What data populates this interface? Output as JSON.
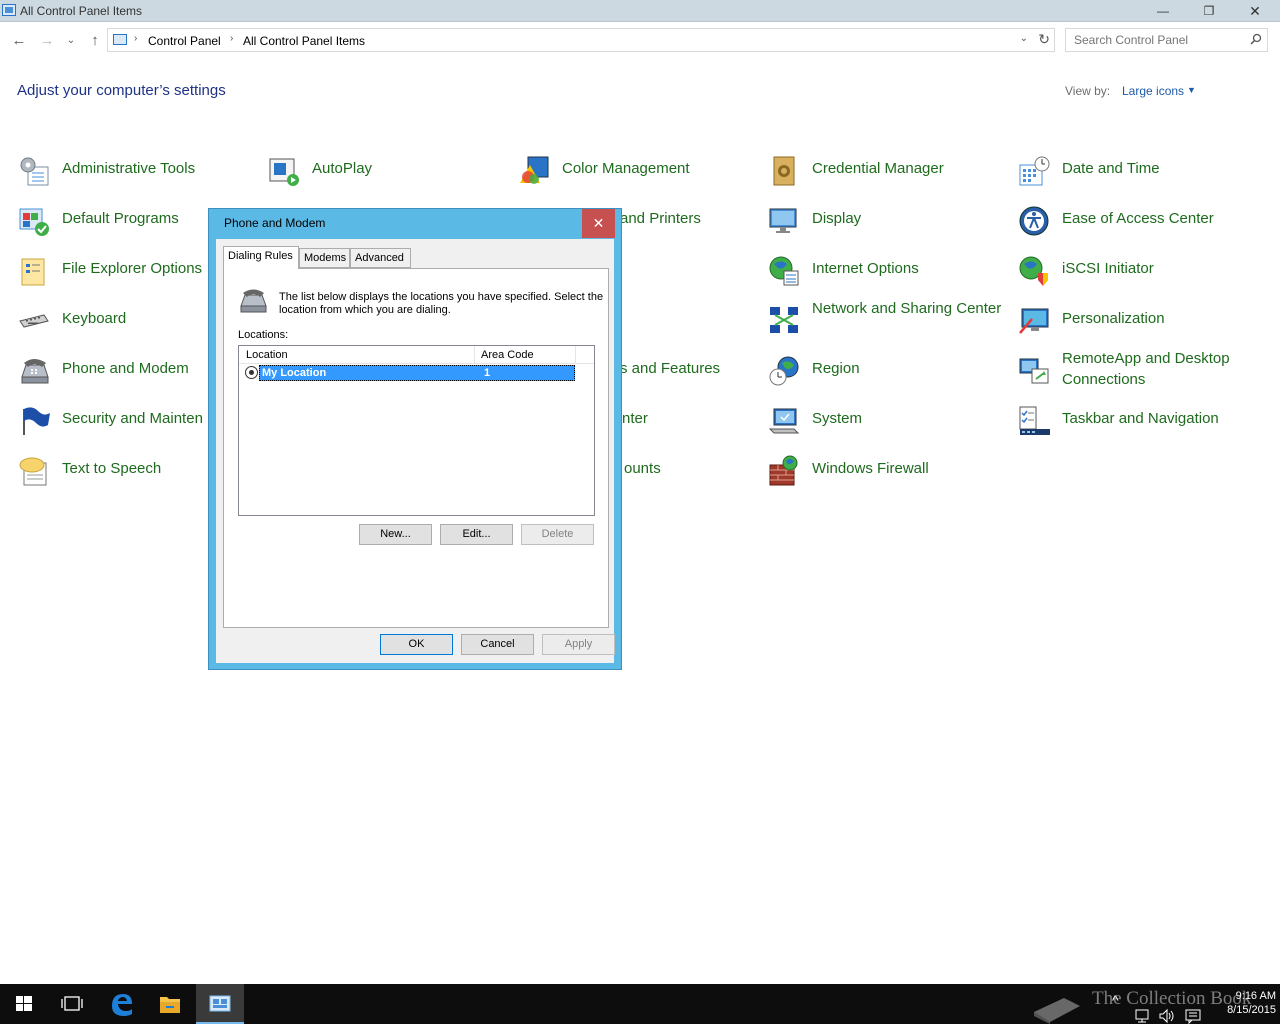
{
  "window": {
    "title": "All Control Panel Items",
    "min_glyph": "—",
    "max_glyph": "❐",
    "close_glyph": "✕"
  },
  "nav": {
    "back_glyph": "←",
    "forward_glyph": "→",
    "recent_glyph": "⌄",
    "up_glyph": "↑",
    "breadcrumb": [
      "Control Panel",
      "All Control Panel Items"
    ],
    "crumb_separator": "›",
    "dropdown_glyph": "⌄",
    "refresh_glyph": "↻",
    "search_placeholder": "Search Control Panel"
  },
  "header": {
    "title": "Adjust your computer’s settings",
    "view_by_label": "View by:",
    "view_by_value": "Large icons",
    "view_by_arrow": "▼"
  },
  "items": [
    {
      "label": "Administrative Tools",
      "icon": "admin-tools-icon"
    },
    {
      "label": "AutoPlay",
      "icon": "autoplay-icon"
    },
    {
      "label": "Color Management",
      "icon": "color-management-icon"
    },
    {
      "label": "Credential Manager",
      "icon": "credential-manager-icon"
    },
    {
      "label": "Date and Time",
      "icon": "date-time-icon"
    },
    {
      "label": "Default Programs",
      "icon": "default-programs-icon"
    },
    {
      "label": "and Printers",
      "icon": ""
    },
    {
      "label": "Display",
      "icon": "display-icon"
    },
    {
      "label": "Ease of Access Center",
      "icon": "ease-of-access-icon"
    },
    {
      "label": "File Explorer Options",
      "icon": "file-explorer-options-icon"
    },
    {
      "label": "Internet Options",
      "icon": "internet-options-icon"
    },
    {
      "label": "iSCSI Initiator",
      "icon": "iscsi-initiator-icon"
    },
    {
      "label": "Keyboard",
      "icon": "keyboard-icon"
    },
    {
      "label": "Network and Sharing Center",
      "icon": "network-sharing-icon"
    },
    {
      "label": "Personalization",
      "icon": "personalization-icon"
    },
    {
      "label": "Phone and Modem",
      "icon": "phone-modem-icon"
    },
    {
      "label": "s and Features",
      "icon": ""
    },
    {
      "label": "Region",
      "icon": "region-icon"
    },
    {
      "label": "RemoteApp and Desktop Connections",
      "icon": "remoteapp-icon"
    },
    {
      "label": "Security and Mainten",
      "icon": "security-maintenance-icon"
    },
    {
      "label": "nter",
      "icon": ""
    },
    {
      "label": "System",
      "icon": "system-icon"
    },
    {
      "label": "Taskbar and Navigation",
      "icon": "taskbar-navigation-icon"
    },
    {
      "label": "Text to Speech",
      "icon": "text-to-speech-icon"
    },
    {
      "label": "ounts",
      "icon": ""
    },
    {
      "label": "Windows Firewall",
      "icon": "windows-firewall-icon"
    }
  ],
  "dialog": {
    "title": "Phone and Modem",
    "close_glyph": "✕",
    "tabs": [
      "Dialing Rules",
      "Modems",
      "Advanced"
    ],
    "description": "The list below displays the locations you have specified. Select the location from which you are dialing.",
    "locations_label": "Locations:",
    "columns": [
      "Location",
      "Area Code"
    ],
    "rows": [
      {
        "location": "My Location",
        "area_code": "1"
      }
    ],
    "buttons": {
      "new": "New...",
      "edit": "Edit...",
      "delete": "Delete",
      "ok": "OK",
      "cancel": "Cancel",
      "apply": "Apply"
    }
  },
  "taskbar": {
    "clock_time": "9:16 AM",
    "clock_date": "8/15/2015",
    "watermark": "The Collection Book"
  }
}
